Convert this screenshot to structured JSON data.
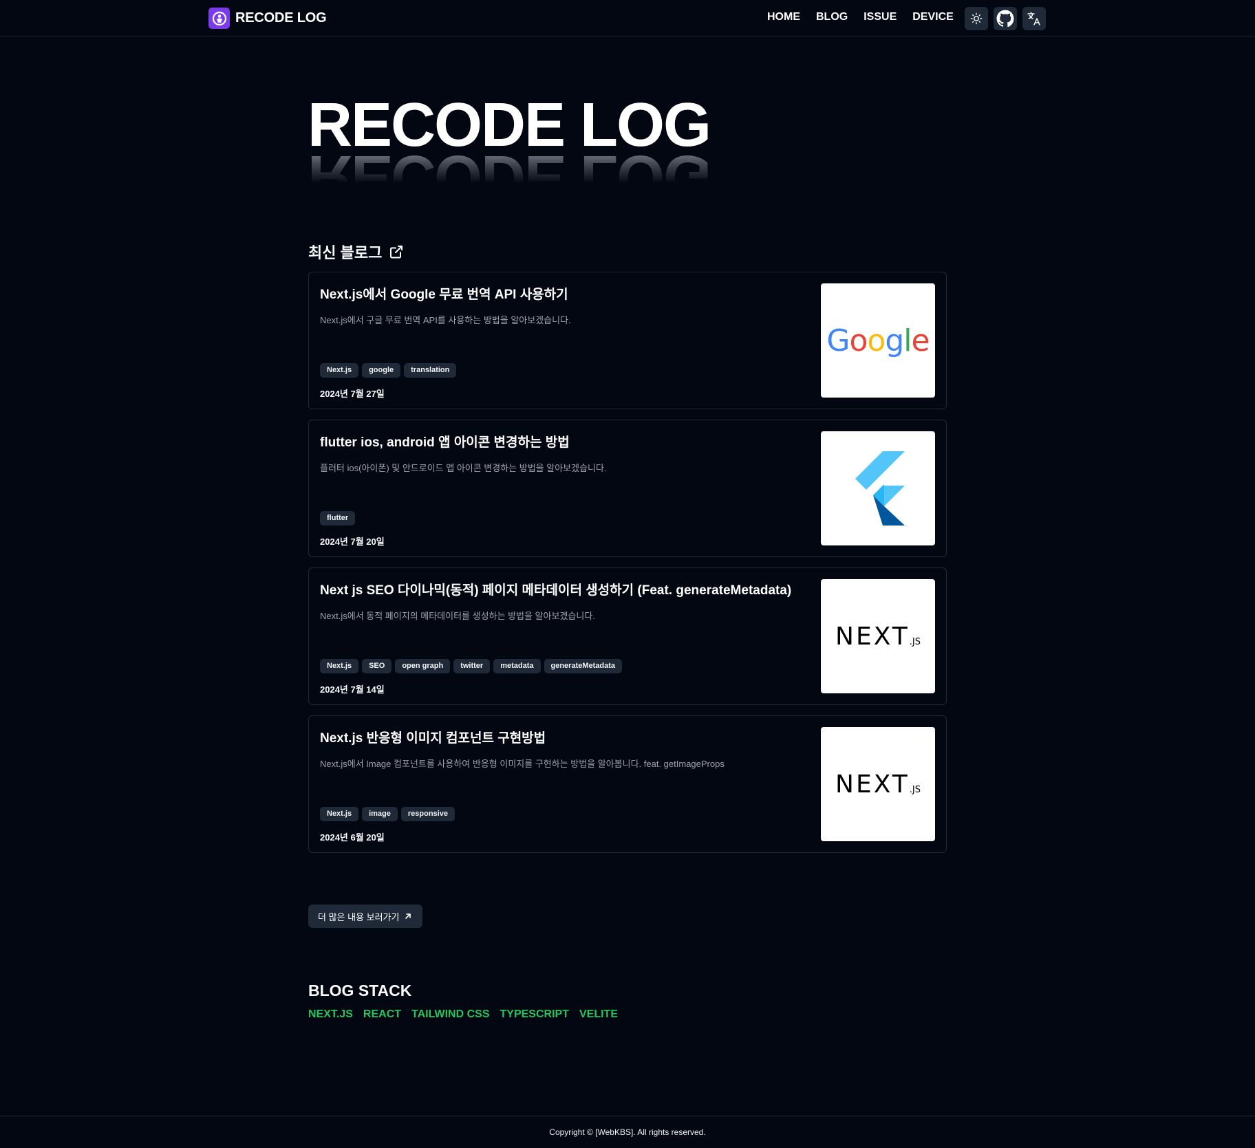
{
  "header": {
    "brand": "RECODE LOG",
    "nav": [
      "HOME",
      "BLOG",
      "ISSUE",
      "DEVICE"
    ],
    "icons": [
      "theme-toggle-icon",
      "github-icon",
      "translate-icon"
    ]
  },
  "hero": {
    "title": "RECODE LOG"
  },
  "latest": {
    "title": "최신 블로그",
    "posts": [
      {
        "title": "Next.js에서 Google 무료 번역 API 사용하기",
        "desc": "Next.js에서 구글 무료 번역 API를 사용하는 방법을 알아보겠습니다.",
        "tags": [
          "Next.js",
          "google",
          "translation"
        ],
        "date": "2024년 7월 27일",
        "thumb": "google",
        "thumb_text": "Google"
      },
      {
        "title": "flutter ios, android 앱 아이콘 변경하는 방법",
        "desc": "플러터 ios(아이폰) 및 안드로이드 앱 아이콘 변경하는 방법을 알아보겠습니다.",
        "tags": [
          "flutter"
        ],
        "date": "2024년 7월 20일",
        "thumb": "flutter",
        "thumb_text": ""
      },
      {
        "title": "Next js SEO 다이나믹(동적) 페이지 메타데이터 생성하기 (Feat. generateMetadata)",
        "desc": "Next.js에서 동적 페이지의 메타데이터를 생성하는 방법을 알아보겠습니다.",
        "tags": [
          "Next.js",
          "SEO",
          "open graph",
          "twitter",
          "metadata",
          "generateMetadata"
        ],
        "date": "2024년 7월 14일",
        "thumb": "nextjs",
        "thumb_text": "NEXT",
        "thumb_sub": ".JS"
      },
      {
        "title": "Next.js 반응형 이미지 컴포넌트 구현방법",
        "desc": "Next.js에서 Image 컴포넌트를 사용하여 반응형 이미지를 구현하는 방법을 알아봅니다. feat. getImageProps",
        "tags": [
          "Next.js",
          "image",
          "responsive"
        ],
        "date": "2024년 6월 20일",
        "thumb": "nextjs",
        "thumb_text": "NEXT",
        "thumb_sub": ".JS"
      }
    ]
  },
  "more_button": "더 많은 내용 보러가기",
  "stack": {
    "title": "BLOG STACK",
    "items": [
      "NEXT.JS",
      "REACT",
      "TAILWIND CSS",
      "TYPESCRIPT",
      "VELITE"
    ]
  },
  "footer": {
    "copyright": "Copyright © [WebKBS]. All rights reserved."
  },
  "colors": {
    "background": "#030712",
    "accent": "#22c55e",
    "brand": "#7c3aed"
  }
}
